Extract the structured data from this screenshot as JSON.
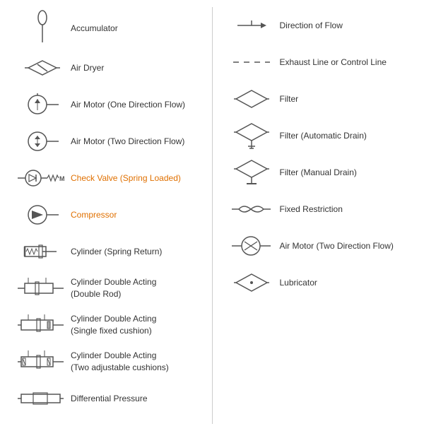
{
  "left_column": [
    {
      "id": "accumulator",
      "label": "Accumulator",
      "orange": false
    },
    {
      "id": "air-dryer",
      "label": "Air Dryer",
      "orange": false
    },
    {
      "id": "air-motor-one",
      "label": "Air Motor (One Direction Flow)",
      "orange": false
    },
    {
      "id": "air-motor-two",
      "label": "Air Motor (Two Direction Flow)",
      "orange": false
    },
    {
      "id": "check-valve",
      "label": "Check Valve (Spring Loaded)",
      "orange": true
    },
    {
      "id": "compressor",
      "label": "Compressor",
      "orange": true
    },
    {
      "id": "cylinder-spring",
      "label": "Cylinder (Spring Return)",
      "orange": false
    },
    {
      "id": "cylinder-double-rod",
      "label": "Cylinder Double Acting\n(Double Rod)",
      "orange": false
    },
    {
      "id": "cylinder-double-single",
      "label": "Cylinder Double Acting\n(Single fixed cushion)",
      "orange": false
    },
    {
      "id": "cylinder-double-two",
      "label": "Cylinder Double Acting\n(Two adjustable cushions)",
      "orange": false
    },
    {
      "id": "differential-pressure",
      "label": "Differential Pressure",
      "orange": false
    }
  ],
  "right_column": [
    {
      "id": "direction-flow",
      "label": "Direction of Flow",
      "orange": false
    },
    {
      "id": "exhaust-line",
      "label": "Exhaust Line or Control Line",
      "orange": false
    },
    {
      "id": "filter",
      "label": "Filter",
      "orange": false
    },
    {
      "id": "filter-auto",
      "label": "Filter (Automatic Drain)",
      "orange": false
    },
    {
      "id": "filter-manual",
      "label": "Filter (Manual Drain)",
      "orange": false
    },
    {
      "id": "fixed-restriction",
      "label": "Fixed Restriction",
      "orange": false
    },
    {
      "id": "air-motor-two-right",
      "label": "Air Motor (Two Direction Flow)",
      "orange": false
    },
    {
      "id": "lubricator",
      "label": "Lubricator",
      "orange": false
    }
  ]
}
